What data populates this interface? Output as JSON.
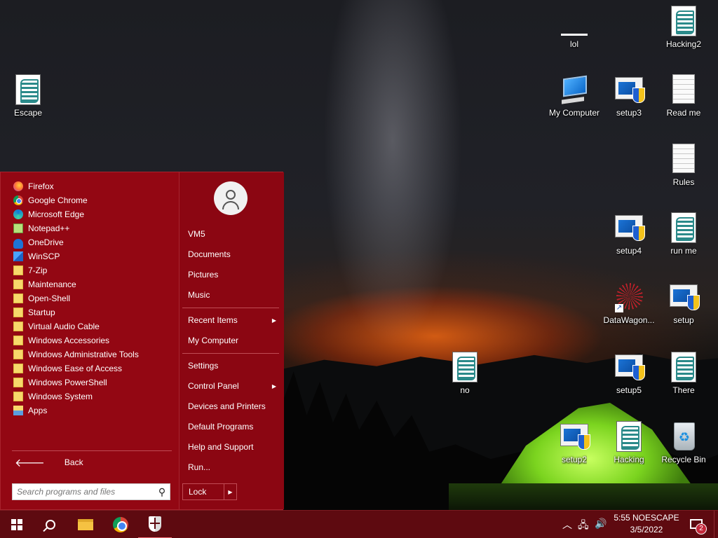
{
  "desktop": {
    "icons": [
      {
        "label": "Escape",
        "icon": "script-icon"
      },
      {
        "label": "lol",
        "icon": "blank-file-icon"
      },
      {
        "label": "Hacking2",
        "icon": "script-icon"
      },
      {
        "label": "My Computer",
        "icon": "computer-icon"
      },
      {
        "label": "setup3",
        "icon": "setup-icon"
      },
      {
        "label": "Read me",
        "icon": "text-document-icon"
      },
      {
        "label": "Rules",
        "icon": "text-document-icon"
      },
      {
        "label": "setup4",
        "icon": "setup-icon"
      },
      {
        "label": "run me",
        "icon": "script-icon"
      },
      {
        "label": "DataWagon...",
        "icon": "shortcut-icon"
      },
      {
        "label": "setup",
        "icon": "setup-icon"
      },
      {
        "label": "no",
        "icon": "script-icon"
      },
      {
        "label": "setup5",
        "icon": "setup-icon"
      },
      {
        "label": "There",
        "icon": "script-icon"
      },
      {
        "label": "setup2",
        "icon": "setup-icon"
      },
      {
        "label": "Hacking",
        "icon": "script-icon"
      },
      {
        "label": "Recycle Bin",
        "icon": "recycle-bin-icon"
      }
    ]
  },
  "start_menu": {
    "programs": [
      {
        "label": "Firefox",
        "icon": "firefox-icon"
      },
      {
        "label": "Google Chrome",
        "icon": "chrome-icon"
      },
      {
        "label": "Microsoft Edge",
        "icon": "edge-icon"
      },
      {
        "label": "Notepad++",
        "icon": "notepadpp-icon"
      },
      {
        "label": "OneDrive",
        "icon": "onedrive-icon"
      },
      {
        "label": "WinSCP",
        "icon": "winscp-icon"
      },
      {
        "label": "7-Zip",
        "icon": "folder-icon"
      },
      {
        "label": "Maintenance",
        "icon": "folder-icon"
      },
      {
        "label": "Open-Shell",
        "icon": "folder-icon"
      },
      {
        "label": "Startup",
        "icon": "folder-icon"
      },
      {
        "label": "Virtual Audio Cable",
        "icon": "folder-icon"
      },
      {
        "label": "Windows Accessories",
        "icon": "folder-icon"
      },
      {
        "label": "Windows Administrative Tools",
        "icon": "folder-icon"
      },
      {
        "label": "Windows Ease of Access",
        "icon": "folder-icon"
      },
      {
        "label": "Windows PowerShell",
        "icon": "folder-icon"
      },
      {
        "label": "Windows System",
        "icon": "folder-icon"
      },
      {
        "label": "Apps",
        "icon": "apps-icon"
      }
    ],
    "back_label": "Back",
    "search_placeholder": "Search programs and files",
    "right": {
      "user": "VM5",
      "documents": "Documents",
      "pictures": "Pictures",
      "music": "Music",
      "recent_items": "Recent Items",
      "my_computer": "My Computer",
      "settings": "Settings",
      "control_panel": "Control Panel",
      "devices_printers": "Devices and Printers",
      "default_programs": "Default Programs",
      "help_support": "Help and Support",
      "run": "Run...",
      "lock": "Lock"
    },
    "submenu_arrow": "▶",
    "lock_arrow": "▶"
  },
  "taskbar": {
    "clock_time": "5:55 NOESCAPE",
    "clock_date": "3/5/2022",
    "notification_count": "2",
    "tray_chevron": "︿",
    "tray_network": "🖧",
    "tray_volume": "🔊"
  },
  "colors": {
    "start_menu_bg": "#8b0612",
    "taskbar_bg": "#5e0a10",
    "accent": "#c4273a"
  }
}
